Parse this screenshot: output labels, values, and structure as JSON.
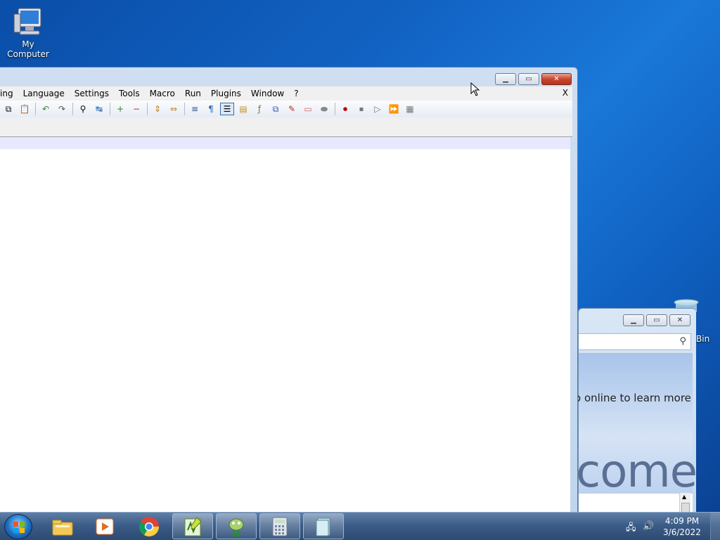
{
  "desktop": {
    "icons": [
      {
        "label": "My Computer",
        "icon": "computer-icon"
      },
      {
        "label": "Bin",
        "icon": "recycle-bin-icon"
      }
    ]
  },
  "main_window": {
    "app": "Notepad++",
    "menu": [
      "ing",
      "Language",
      "Settings",
      "Tools",
      "Macro",
      "Run",
      "Plugins",
      "Window",
      "?"
    ],
    "close_doc": "X",
    "toolbar_icons": [
      "copy-icon",
      "paste-icon",
      "undo-icon",
      "redo-icon",
      "find-icon",
      "replace-icon",
      "zoom-in-icon",
      "zoom-out-icon",
      "sync-vertical-icon",
      "sync-horizontal-icon",
      "word-wrap-icon",
      "show-all-chars-icon",
      "indent-guide-icon",
      "doc-map-icon",
      "function-list-icon",
      "folder-workspace-icon",
      "doc-switcher-icon",
      "monitor-icon",
      "record-macro-icon",
      "stop-macro-icon",
      "play-macro-icon",
      "run-macro-multiple-icon",
      "save-macro-icon"
    ]
  },
  "background_window": {
    "text": "o online to learn more",
    "big_text": "come"
  },
  "taskbar": {
    "pinned": [
      "explorer-icon",
      "media-player-icon",
      "chrome-icon",
      "notepadpp-icon",
      "notepad-plugin-icon",
      "calculator-icon",
      "document-icon"
    ],
    "time": "4:09 PM",
    "date": "3/6/2022"
  },
  "colors": {
    "desktop": "#1263c4",
    "taskbar": "#3c5d87",
    "close_button": "#c7462f"
  }
}
